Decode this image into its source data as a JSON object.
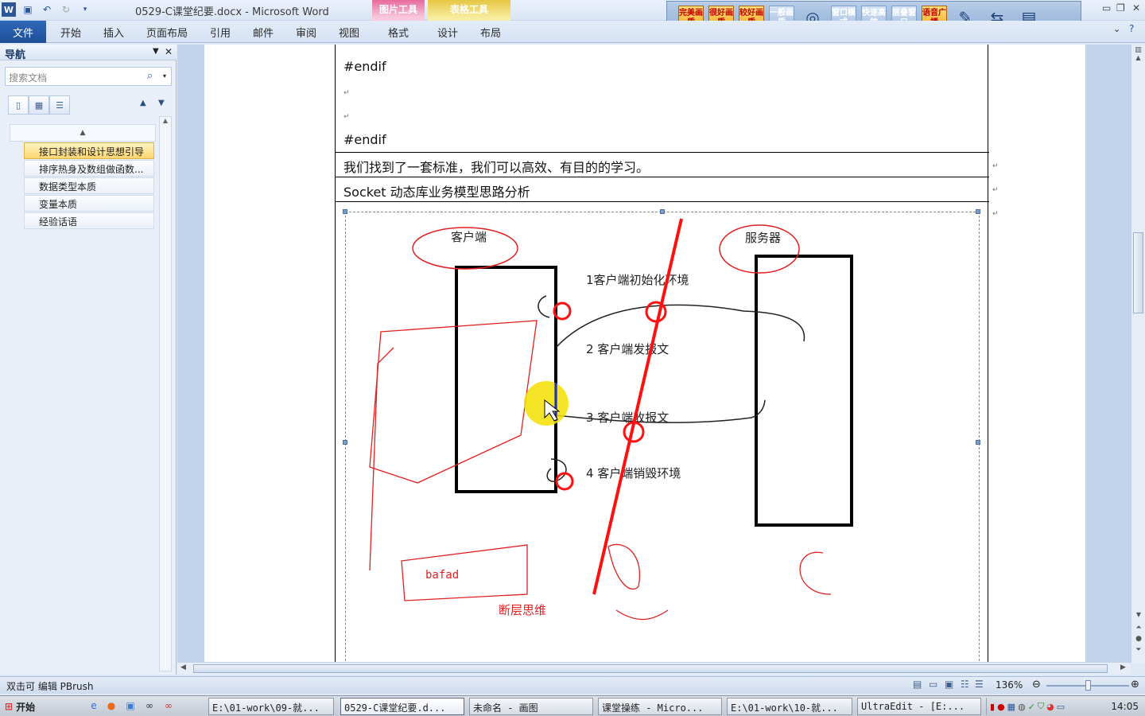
{
  "window": {
    "title": "0529-C课堂纪要.docx - Microsoft Word",
    "context_tabs": [
      "图片工具",
      "表格工具"
    ]
  },
  "ribbon": {
    "file_tab": "文件",
    "tabs": [
      "开始",
      "插入",
      "页面布局",
      "引用",
      "邮件",
      "审阅",
      "视图",
      "格式",
      "设计",
      "布局"
    ]
  },
  "addin_bar": {
    "buttons": [
      {
        "label": "完美画质"
      },
      {
        "label": "很好画质"
      },
      {
        "label": "较好画质"
      },
      {
        "label": "一般画质"
      },
      {
        "label": "窗口模式"
      },
      {
        "label": "快速高效"
      },
      {
        "label": "层叠窗口"
      },
      {
        "label": "语音广播"
      }
    ]
  },
  "nav": {
    "title": "导航",
    "search_placeholder": "搜索文档",
    "items": [
      {
        "label": "接口封装和设计思想引导",
        "selected": true
      },
      {
        "label": "排序热身及数组做函数...",
        "selected": false
      },
      {
        "label": "数据类型本质",
        "selected": false
      },
      {
        "label": "变量本质",
        "selected": false
      },
      {
        "label": "经验话语",
        "selected": false
      }
    ]
  },
  "document": {
    "lines": [
      "#endif",
      "#endif"
    ],
    "row1": "我们找到了一套标准，我们可以高效、有目的的学习。",
    "row2": "Socket 动态库业务模型思路分析",
    "diagram": {
      "client_label": "客户端",
      "server_label": "服务器",
      "steps": [
        "1客户端初始化环境",
        "2  客户端发报文",
        "3  客户端收报文",
        "4  客户端销毁环境"
      ],
      "note": "断层思维",
      "scribble_text": "bafad"
    }
  },
  "status": {
    "left_text": "双击可 编辑 PBrush",
    "zoom": "136%",
    "zoom_fraction": 0.5
  },
  "taskbar": {
    "start_label": "开始",
    "tasks": [
      {
        "label": "E:\\01-work\\09-就..."
      },
      {
        "label": "0529-C课堂纪要.d...",
        "active": true
      },
      {
        "label": "未命名 - 画图"
      },
      {
        "label": "课堂操练 - Micro..."
      },
      {
        "label": "E:\\01-work\\10-就..."
      },
      {
        "label": "UltraEdit - [E:..."
      }
    ],
    "clock": "14:05"
  }
}
